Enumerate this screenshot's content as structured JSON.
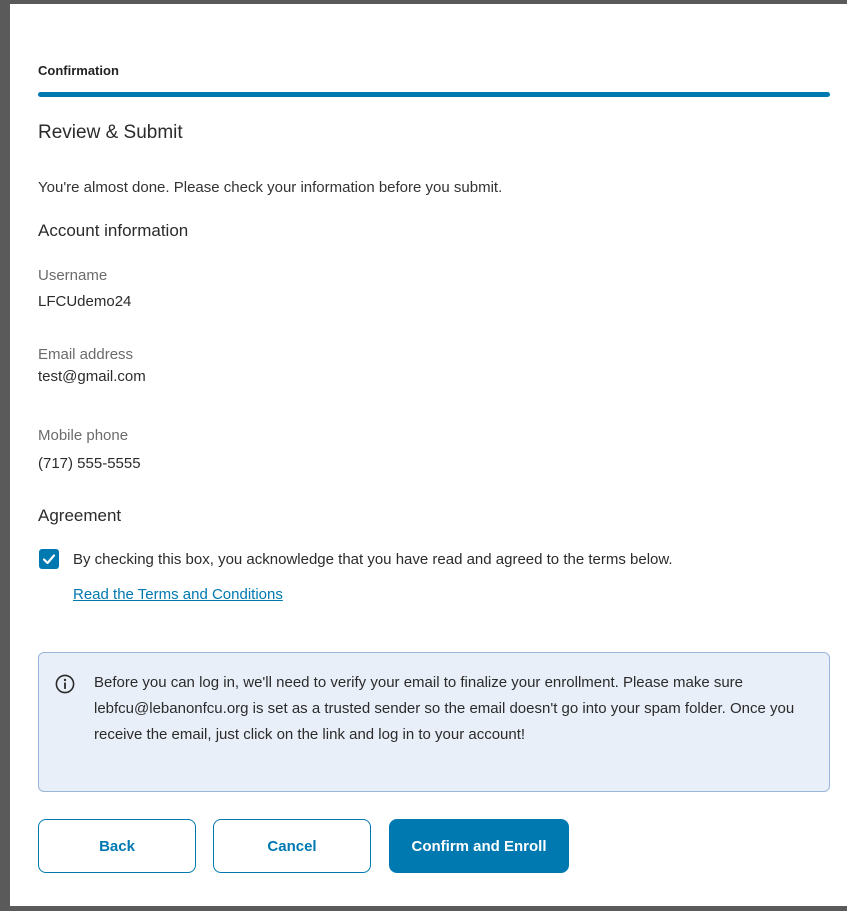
{
  "progress": {
    "step_label": "Confirmation",
    "percent": 100,
    "color": "#0079b1"
  },
  "page": {
    "title": "Review & Submit",
    "intro": "You're almost done. Please check your information before you submit."
  },
  "account": {
    "heading": "Account information",
    "username_label": "Username",
    "username_value": "LFCUdemo24",
    "email_label": "Email address",
    "email_value": "test@gmail.com",
    "phone_label": "Mobile phone",
    "phone_value": "(717) 555-5555"
  },
  "agreement": {
    "heading": "Agreement",
    "checked": true,
    "checkbox_text": "By checking this box, you acknowledge that you have read and agreed to the terms below.",
    "link_text": "Read the Terms and Conditions"
  },
  "notice": {
    "icon": "info-icon",
    "text": "Before you can log in, we'll need to verify your email to finalize your enrollment. Please make sure lebfcu@lebanonfcu.org is set as a trusted sender so the email doesn't go into your spam folder. Once you receive the email, just click on the link and log in to your account!"
  },
  "buttons": {
    "back": "Back",
    "cancel": "Cancel",
    "confirm": "Confirm and Enroll"
  },
  "colors": {
    "accent": "#0079b1",
    "notice_bg": "#e9eff8",
    "notice_border": "#9cb6d9"
  }
}
